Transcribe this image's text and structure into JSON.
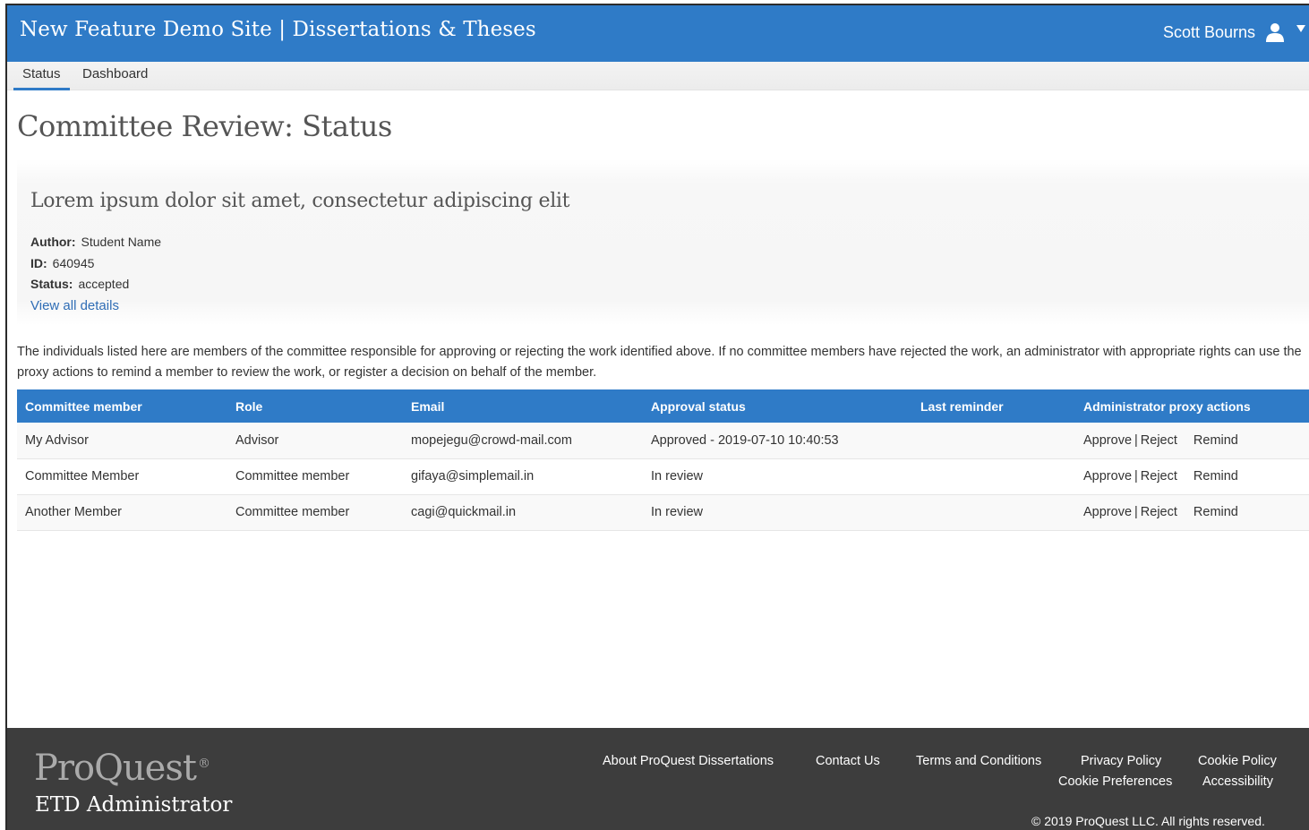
{
  "header": {
    "site_title": "New Feature Demo Site | Dissertations & Theses",
    "user_name": "Scott Bourns"
  },
  "tabs": [
    {
      "label": "Status",
      "active": true
    },
    {
      "label": "Dashboard",
      "active": false
    }
  ],
  "page_title": "Committee Review: Status",
  "work": {
    "title": "Lorem ipsum dolor sit amet, consectetur adipiscing elit",
    "author_label": "Author:",
    "author": "Student Name",
    "id_label": "ID:",
    "id": "640945",
    "status_label": "Status:",
    "status": "accepted",
    "details_link": "View all details"
  },
  "intro_text": "The individuals listed here are members of the committee responsible for approving or rejecting the work identified above. If no committee members have rejected the work, an administrator with appropriate rights can use the proxy actions to remind a member to review the work, or register a decision on behalf of the member.",
  "table": {
    "columns": [
      "Committee member",
      "Role",
      "Email",
      "Approval status",
      "Last reminder",
      "Administrator proxy actions"
    ],
    "rows": [
      {
        "member": "My Advisor",
        "role": "Advisor",
        "email": "mopejegu@crowd-mail.com",
        "approval": "Approved - 2019-07-10 10:40:53",
        "last_reminder": "",
        "approve": "Approve",
        "reject": "Reject",
        "remind": "Remind"
      },
      {
        "member": "Committee Member",
        "role": "Committee member",
        "email": "gifaya@simplemail.in",
        "approval": "In review",
        "last_reminder": "",
        "approve": "Approve",
        "reject": "Reject",
        "remind": "Remind"
      },
      {
        "member": "Another Member",
        "role": "Committee member",
        "email": "cagi@quickmail.in",
        "approval": "In review",
        "last_reminder": "",
        "approve": "Approve",
        "reject": "Reject",
        "remind": "Remind"
      }
    ]
  },
  "footer": {
    "logo": "ProQuest",
    "logo_mark": "®",
    "logo_sub": "ETD Administrator",
    "links": {
      "about": "About ProQuest Dissertations",
      "contact": "Contact Us",
      "terms": "Terms and Conditions",
      "privacy": "Privacy Policy",
      "cookie_policy": "Cookie Policy",
      "cookie_prefs": "Cookie Preferences",
      "accessibility": "Accessibility"
    },
    "copyright": "© 2019 ProQuest LLC. All rights reserved."
  },
  "colors": {
    "brand_blue": "#2f7bc7",
    "footer_bg": "#3d3d3d",
    "link": "#2f6db5"
  }
}
